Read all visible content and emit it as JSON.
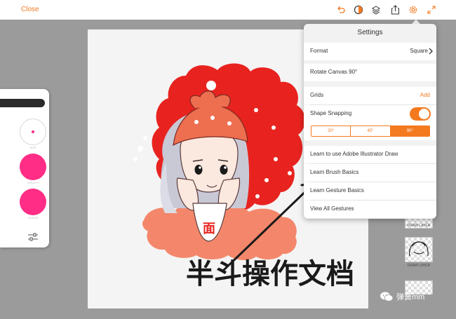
{
  "topbar": {
    "close_label": "Close",
    "icons": [
      "undo-icon",
      "opacity-icon",
      "layers-icon",
      "share-icon",
      "gear-icon",
      "expand-icon"
    ]
  },
  "colors": {
    "accent": "#f47a20",
    "workspace": "#9b9b9b",
    "brush_color": "#ff2d86"
  },
  "tool_panel": {
    "size_label": "SIZE",
    "opacity_label": "OPACITY",
    "color_label": "COLOR"
  },
  "layers": [
    {
      "label": "DRAW LAYER"
    },
    {
      "label": "DRAW LAYER"
    }
  ],
  "settings": {
    "title": "Settings",
    "format_label": "Format",
    "format_value": "Square",
    "rotate_label": "Rotate Canvas 90°",
    "grids_label": "Grids",
    "grids_action": "Add",
    "snapping_label": "Shape Snapping",
    "snapping_on": true,
    "angles": [
      "30°",
      "45°",
      "90°"
    ],
    "angle_selected": "90°",
    "links": [
      "Learn to use Adobe Illustrator Draw",
      "Learn Brush Basics",
      "Learn Gesture Basics",
      "View All Gestures"
    ]
  },
  "canvas": {
    "headband_text": "面",
    "caption_text": "半斗操作文档"
  },
  "watermark": {
    "text": "弹簧mm"
  }
}
